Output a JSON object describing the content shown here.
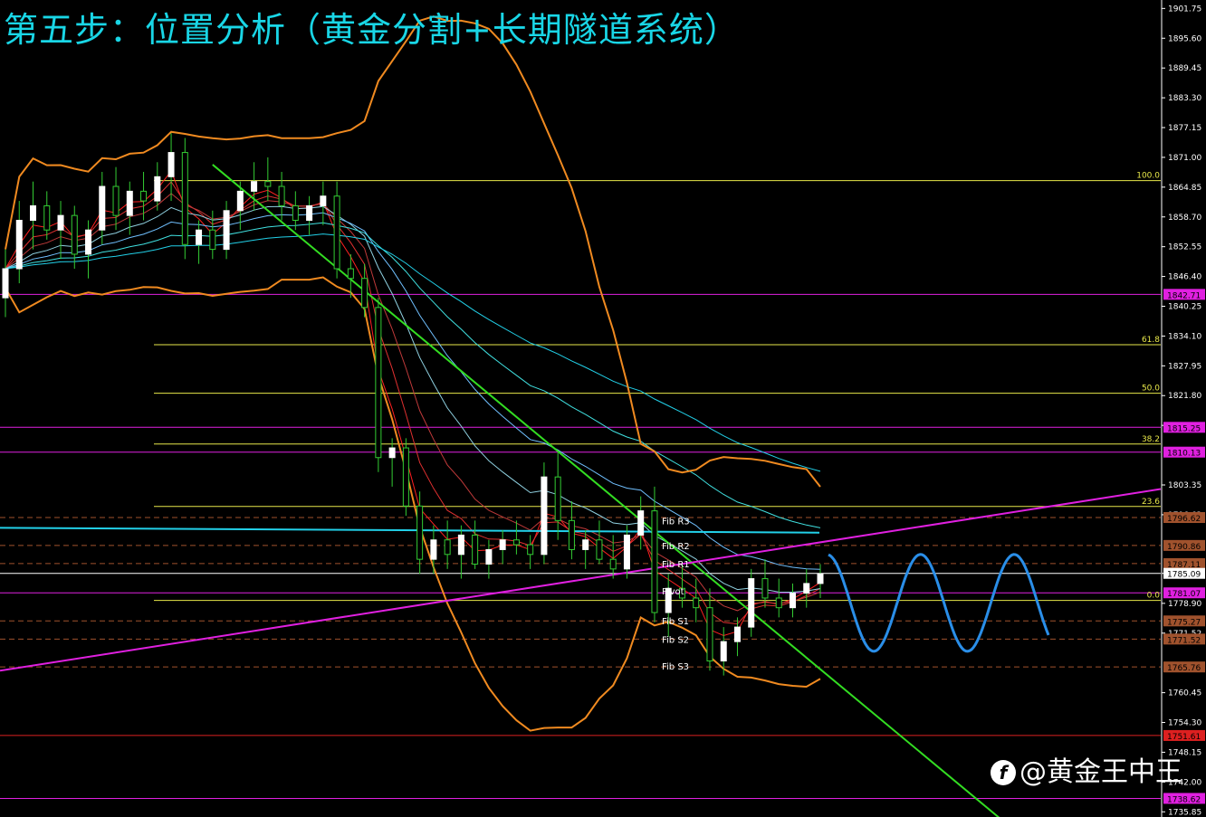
{
  "title": "第五步：位置分析（黄金分割+长期隧道系统）",
  "watermark": "@黄金王中王",
  "colors": {
    "background": "#000000",
    "title": "#19d6e6",
    "fib": "#e8e84a",
    "pivot_line": "#9b4dca",
    "bands": "#f08a20",
    "trendline": "#33dd22",
    "support_line": "#e020e0",
    "tunnel": "#22d0e8",
    "projection": "#2a8ee8",
    "bull_candle": "#ffffff",
    "bear_candle": "#33cc33"
  },
  "chart_data": {
    "type": "candlestick",
    "y_axis": {
      "min": 1735.9,
      "max": 1902.0,
      "ticks": [
        1901.75,
        1895.6,
        1889.45,
        1883.3,
        1877.15,
        1871.0,
        1864.85,
        1858.7,
        1852.55,
        1846.4,
        1840.25,
        1834.1,
        1827.95,
        1821.8,
        1815.65,
        1803.35,
        1797.2,
        1785.09,
        1778.9,
        1772.75,
        1760.45,
        1754.3,
        1748.15,
        1742.0,
        1735.85
      ],
      "tick_labels": [
        "1901.75",
        "1895.60",
        "1889.45",
        "1883.30",
        "1877.15",
        "1871.00",
        "1864.85",
        "1858.70",
        "1852.55",
        "1846.40",
        "1840.25",
        "1834.10",
        "1827.95",
        "1821.80",
        "1815.25",
        "1803.35",
        "1796.62",
        "1785.09",
        "1778.90",
        "1771.52",
        "1760.45",
        "1754.30",
        "1748.15",
        "1742.00",
        "1735.85"
      ]
    },
    "price_badges": [
      {
        "label": "1842.71",
        "value": 1842.71,
        "color": "#e020e0"
      },
      {
        "label": "1815.25",
        "value": 1815.25,
        "color": "#e020e0"
      },
      {
        "label": "1810.13",
        "value": 1810.13,
        "color": "#e020e0"
      },
      {
        "label": "1796.62",
        "value": 1796.62,
        "color": "#a0522d"
      },
      {
        "label": "1790.86",
        "value": 1790.86,
        "color": "#a0522d"
      },
      {
        "label": "1787.11",
        "value": 1787.11,
        "color": "#a0522d"
      },
      {
        "label": "1785.09",
        "value": 1785.09,
        "color": "#ffffff"
      },
      {
        "label": "1781.07",
        "value": 1781.07,
        "color": "#e020e0"
      },
      {
        "label": "1775.27",
        "value": 1775.27,
        "color": "#a0522d"
      },
      {
        "label": "1771.52",
        "value": 1771.52,
        "color": "#a0522d"
      },
      {
        "label": "1765.76",
        "value": 1765.76,
        "color": "#a0522d"
      },
      {
        "label": "1751.61",
        "value": 1751.61,
        "color": "#dd2020"
      },
      {
        "label": "1738.62",
        "value": 1738.62,
        "color": "#e020e0"
      }
    ],
    "fib_levels": [
      {
        "label": "100.0",
        "value": 1866.2
      },
      {
        "label": "61.8",
        "value": 1832.3
      },
      {
        "label": "50.0",
        "value": 1822.3
      },
      {
        "label": "38.2",
        "value": 1811.8
      },
      {
        "label": "23.6",
        "value": 1798.9
      },
      {
        "label": "0.0",
        "value": 1779.5
      }
    ],
    "pivot_labels": [
      {
        "label": "Fib R3",
        "value": 1796.0
      },
      {
        "label": "Fib R2",
        "value": 1790.8
      },
      {
        "label": "Fib R1",
        "value": 1787.1
      },
      {
        "label": "Pivot",
        "value": 1781.5
      },
      {
        "label": "Fib S1",
        "value": 1775.3
      },
      {
        "label": "Fib S2",
        "value": 1771.5
      },
      {
        "label": "Fib S3",
        "value": 1766.0
      }
    ],
    "candles": [
      {
        "o": 1842,
        "h": 1852,
        "l": 1838,
        "c": 1848
      },
      {
        "o": 1848,
        "h": 1862,
        "l": 1845,
        "c": 1858
      },
      {
        "o": 1858,
        "h": 1866,
        "l": 1852,
        "c": 1861
      },
      {
        "o": 1861,
        "h": 1864,
        "l": 1854,
        "c": 1856
      },
      {
        "o": 1856,
        "h": 1862,
        "l": 1850,
        "c": 1859
      },
      {
        "o": 1859,
        "h": 1861,
        "l": 1848,
        "c": 1851
      },
      {
        "o": 1851,
        "h": 1858,
        "l": 1846,
        "c": 1856
      },
      {
        "o": 1856,
        "h": 1868,
        "l": 1853,
        "c": 1865
      },
      {
        "o": 1865,
        "h": 1869,
        "l": 1856,
        "c": 1859
      },
      {
        "o": 1859,
        "h": 1866,
        "l": 1855,
        "c": 1864
      },
      {
        "o": 1864,
        "h": 1868,
        "l": 1858,
        "c": 1862
      },
      {
        "o": 1862,
        "h": 1870,
        "l": 1860,
        "c": 1867
      },
      {
        "o": 1867,
        "h": 1876,
        "l": 1862,
        "c": 1872
      },
      {
        "o": 1872,
        "h": 1875,
        "l": 1850,
        "c": 1853
      },
      {
        "o": 1853,
        "h": 1858,
        "l": 1849,
        "c": 1856
      },
      {
        "o": 1856,
        "h": 1860,
        "l": 1850,
        "c": 1852
      },
      {
        "o": 1852,
        "h": 1862,
        "l": 1850,
        "c": 1860
      },
      {
        "o": 1860,
        "h": 1866,
        "l": 1856,
        "c": 1864
      },
      {
        "o": 1864,
        "h": 1870,
        "l": 1860,
        "c": 1866
      },
      {
        "o": 1866,
        "h": 1871,
        "l": 1862,
        "c": 1865
      },
      {
        "o": 1865,
        "h": 1868,
        "l": 1858,
        "c": 1861
      },
      {
        "o": 1861,
        "h": 1864,
        "l": 1856,
        "c": 1858
      },
      {
        "o": 1858,
        "h": 1863,
        "l": 1855,
        "c": 1861
      },
      {
        "o": 1861,
        "h": 1866,
        "l": 1857,
        "c": 1863
      },
      {
        "o": 1863,
        "h": 1866,
        "l": 1846,
        "c": 1848
      },
      {
        "o": 1848,
        "h": 1851,
        "l": 1842,
        "c": 1846
      },
      {
        "o": 1846,
        "h": 1849,
        "l": 1838,
        "c": 1840
      },
      {
        "o": 1840,
        "h": 1842,
        "l": 1806,
        "c": 1809
      },
      {
        "o": 1809,
        "h": 1813,
        "l": 1803,
        "c": 1811
      },
      {
        "o": 1811,
        "h": 1813,
        "l": 1797,
        "c": 1799
      },
      {
        "o": 1799,
        "h": 1802,
        "l": 1785,
        "c": 1788
      },
      {
        "o": 1788,
        "h": 1795,
        "l": 1785,
        "c": 1792
      },
      {
        "o": 1792,
        "h": 1796,
        "l": 1786,
        "c": 1789
      },
      {
        "o": 1789,
        "h": 1795,
        "l": 1784,
        "c": 1793
      },
      {
        "o": 1793,
        "h": 1796,
        "l": 1786,
        "c": 1787
      },
      {
        "o": 1787,
        "h": 1792,
        "l": 1784,
        "c": 1790
      },
      {
        "o": 1790,
        "h": 1794,
        "l": 1787,
        "c": 1792
      },
      {
        "o": 1792,
        "h": 1796,
        "l": 1789,
        "c": 1791
      },
      {
        "o": 1791,
        "h": 1793,
        "l": 1786,
        "c": 1789
      },
      {
        "o": 1789,
        "h": 1808,
        "l": 1787,
        "c": 1805
      },
      {
        "o": 1805,
        "h": 1810,
        "l": 1792,
        "c": 1796
      },
      {
        "o": 1796,
        "h": 1800,
        "l": 1788,
        "c": 1790
      },
      {
        "o": 1790,
        "h": 1794,
        "l": 1786,
        "c": 1792
      },
      {
        "o": 1792,
        "h": 1796,
        "l": 1787,
        "c": 1788
      },
      {
        "o": 1788,
        "h": 1793,
        "l": 1784,
        "c": 1786
      },
      {
        "o": 1786,
        "h": 1795,
        "l": 1784,
        "c": 1793
      },
      {
        "o": 1793,
        "h": 1801,
        "l": 1790,
        "c": 1798
      },
      {
        "o": 1798,
        "h": 1803,
        "l": 1775,
        "c": 1777
      },
      {
        "o": 1777,
        "h": 1785,
        "l": 1772,
        "c": 1782
      },
      {
        "o": 1782,
        "h": 1787,
        "l": 1778,
        "c": 1780
      },
      {
        "o": 1780,
        "h": 1784,
        "l": 1775,
        "c": 1778
      },
      {
        "o": 1778,
        "h": 1782,
        "l": 1765,
        "c": 1767
      },
      {
        "o": 1767,
        "h": 1774,
        "l": 1764,
        "c": 1771
      },
      {
        "o": 1771,
        "h": 1776,
        "l": 1768,
        "c": 1774
      },
      {
        "o": 1774,
        "h": 1786,
        "l": 1772,
        "c": 1784
      },
      {
        "o": 1784,
        "h": 1788,
        "l": 1778,
        "c": 1780
      },
      {
        "o": 1780,
        "h": 1784,
        "l": 1776,
        "c": 1778
      },
      {
        "o": 1778,
        "h": 1783,
        "l": 1776,
        "c": 1781
      },
      {
        "o": 1781,
        "h": 1786,
        "l": 1778,
        "c": 1783
      },
      {
        "o": 1783,
        "h": 1787,
        "l": 1780,
        "c": 1785
      }
    ]
  }
}
